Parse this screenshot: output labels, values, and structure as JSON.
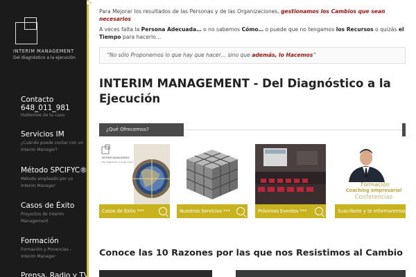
{
  "sidebar": {
    "logo_title": "INTERIM MANAGEMENT",
    "logo_subtitle": "Del diagnóstico a la ejecución",
    "items": [
      {
        "label": "Contacto",
        "label2": "648_011_981",
        "desc": "Hablemos de tu caso"
      },
      {
        "label": "Servicios IM",
        "desc": "¿Cuándo puede contar con un Interim Manager?"
      },
      {
        "label": "Método SPCIFYC®",
        "desc": "Método empleado por un Interim Manager"
      },
      {
        "label": "Casos de Éxito",
        "desc": "Proyectos de Interim Management"
      },
      {
        "label": "Formación",
        "desc": "Formación y Ponencias – Interim Manager"
      },
      {
        "label": "Prensa, Radio y TV",
        "desc": ""
      }
    ]
  },
  "intro": {
    "p1_before": "Para Mejorar los resultados de las Personas y de las Organizaciones, ",
    "p1_highlight": "gestionamos los Cambios que sean necesarios",
    "p2_a": "A veces falta la ",
    "p2_b": "Persona Adecuada…",
    "p2_c": " o no sabemos ",
    "p2_d": "Cómo…",
    "p2_e": " o puede que no tengamos ",
    "p2_f": "los Recursos",
    "p2_g": " o quizás ",
    "p2_h": "el Tiempo",
    "p2_i": " para hacerlo…"
  },
  "quote": {
    "before": "“No sólo Proponemos lo que hay que hacer… sino que ",
    "highlight": "además, lo Hacemos",
    "after": "”"
  },
  "main_title": "INTERIM MANAGEMENT - Del Diagnóstico a la Ejecución",
  "section_label": "¿Qué Ofrecemos?",
  "cards": [
    {
      "caption": "Casos de Éxito ***"
    },
    {
      "caption": "Nuestros Servicios ***"
    },
    {
      "caption": "Próximos Eventos ***"
    },
    {
      "caption": "Suscríbete y te informaremos",
      "overlay1": "Formación",
      "overlay2": "Coaching empresarial",
      "overlay3": "Conferencias"
    }
  ],
  "card1_logo_title": "INTERIM MANAGEMENT",
  "card1_logo_subtitle": "Del diagnóstico a la ejecución",
  "bottom_title": "Conoce las 10 Razones por las que nos Resistimos al Cambio",
  "colors": {
    "accent": "#c8b21e",
    "highlight": "#a31515",
    "sidebar": "#1b1b1b"
  }
}
